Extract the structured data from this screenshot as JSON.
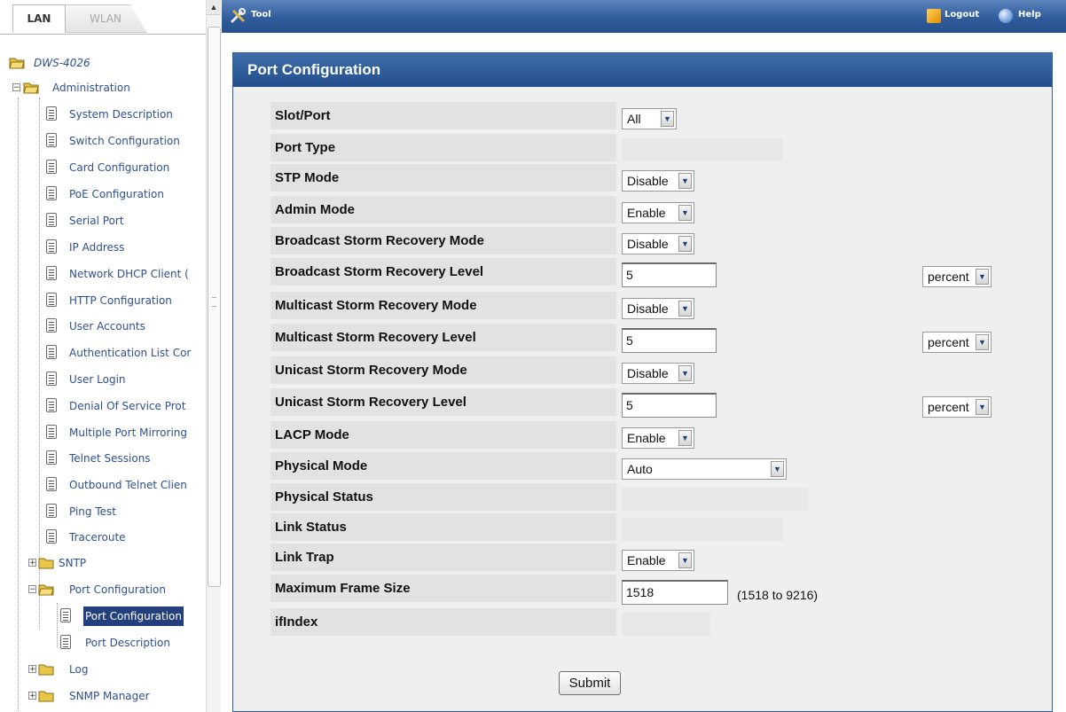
{
  "tabs": {
    "lan": "LAN",
    "wlan": "WLAN"
  },
  "topbar": {
    "tool": "Tool",
    "logout": "Logout",
    "help": "Help"
  },
  "tree": {
    "root": "DWS-4026",
    "administration": "Administration",
    "items": [
      "System Description",
      "Switch Configuration",
      "Card Configuration",
      "PoE Configuration",
      "Serial Port",
      "IP Address",
      "Network DHCP Client (",
      "HTTP Configuration",
      "User Accounts",
      "Authentication List Cor",
      "User Login",
      "Denial Of Service Prot",
      "Multiple Port Mirroring",
      "Telnet Sessions",
      "Outbound Telnet Clien",
      "Ping Test",
      "Traceroute"
    ],
    "sntp": "SNTP",
    "port_configuration_folder": "Port Configuration",
    "port_configuration_item": "Port Configuration",
    "port_description_item": "Port Description",
    "log": "Log",
    "snmp_manager": "SNMP Manager"
  },
  "panel": {
    "title": "Port Configuration"
  },
  "form": {
    "slot_port": {
      "label": "Slot/Port",
      "value": "All"
    },
    "port_type": {
      "label": "Port Type"
    },
    "stp_mode": {
      "label": "STP Mode",
      "value": "Disable"
    },
    "admin_mode": {
      "label": "Admin Mode",
      "value": "Enable"
    },
    "bcast_mode": {
      "label": "Broadcast Storm Recovery Mode",
      "value": "Disable"
    },
    "bcast_level": {
      "label": "Broadcast Storm Recovery Level",
      "value": "5",
      "unit": "percent"
    },
    "mcast_mode": {
      "label": "Multicast Storm Recovery Mode",
      "value": "Disable"
    },
    "mcast_level": {
      "label": "Multicast Storm Recovery Level",
      "value": "5",
      "unit": "percent"
    },
    "ucast_mode": {
      "label": "Unicast Storm Recovery Mode",
      "value": "Disable"
    },
    "ucast_level": {
      "label": "Unicast Storm Recovery Level",
      "value": "5",
      "unit": "percent"
    },
    "lacp_mode": {
      "label": "LACP Mode",
      "value": "Enable"
    },
    "physical_mode": {
      "label": "Physical Mode",
      "value": "Auto"
    },
    "physical_status": {
      "label": "Physical Status"
    },
    "link_status": {
      "label": "Link Status"
    },
    "link_trap": {
      "label": "Link Trap",
      "value": "Enable"
    },
    "max_frame": {
      "label": "Maximum Frame Size",
      "value": "1518",
      "range": "(1518 to 9216)"
    },
    "ifindex": {
      "label": "ifIndex"
    }
  },
  "submit_label": "Submit",
  "colors": {
    "header_blue": "#2f5c9c",
    "selected_bg": "#243f7e",
    "tree_text": "#2d4f91"
  }
}
